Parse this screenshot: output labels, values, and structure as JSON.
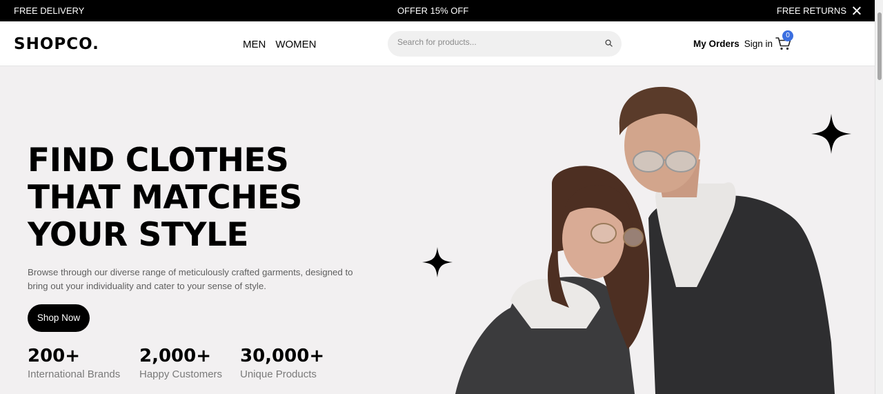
{
  "topbar": {
    "left": "FREE DELIVERY",
    "center": "OFFER 15% OFF",
    "right": "FREE RETURNS"
  },
  "header": {
    "logo": "SHOPCO.",
    "nav": [
      "MEN",
      "WOMEN"
    ],
    "search_placeholder": "Search for products...",
    "my_orders": "My Orders",
    "sign_in": "Sign in",
    "cart_count": "0"
  },
  "hero": {
    "headline": [
      "FIND CLOTHES",
      "THAT MATCHES",
      "YOUR STYLE"
    ],
    "subtext": "Browse through our diverse range of meticulously crafted garments, designed to bring out your individuality and cater to your sense of style.",
    "button": "Shop Now",
    "stats": [
      {
        "value": "200+",
        "label": "International Brands"
      },
      {
        "value": "2,000+",
        "label": "Happy Customers"
      },
      {
        "value": "30,000+",
        "label": "Unique Products"
      }
    ]
  },
  "colors": {
    "topbar_bg": "#000000",
    "hero_bg": "#f2f0f1",
    "badge": "#3b6fe0"
  },
  "icons": [
    "close-icon",
    "search-icon",
    "cart-icon",
    "sparkle-star-icon"
  ]
}
